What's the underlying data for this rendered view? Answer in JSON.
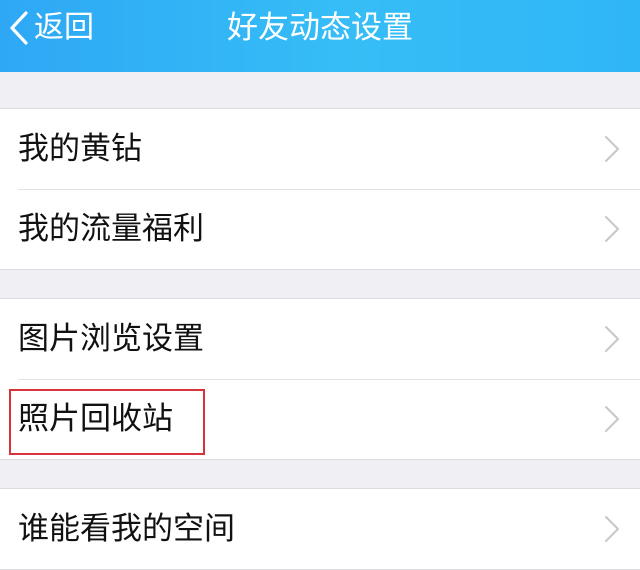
{
  "nav": {
    "back_label": "返回",
    "title": "好友动态设置",
    "background": "#36bdf6"
  },
  "groups": [
    {
      "items": [
        {
          "label": "我的黄钻",
          "icon": "chevron-right-icon"
        },
        {
          "label": "我的流量福利",
          "icon": "chevron-right-icon"
        }
      ]
    },
    {
      "items": [
        {
          "label": "图片浏览设置",
          "icon": "chevron-right-icon"
        },
        {
          "label": "照片回收站",
          "icon": "chevron-right-icon",
          "highlighted": true
        }
      ]
    },
    {
      "items": [
        {
          "label": "谁能看我的空间",
          "icon": "chevron-right-icon"
        }
      ]
    }
  ],
  "highlight_color": "#d6333a"
}
